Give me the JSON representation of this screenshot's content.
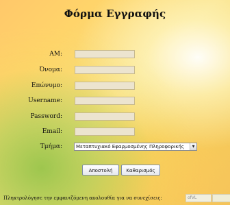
{
  "title": "Φόρμα Εγγραφής",
  "form": {
    "fields": [
      {
        "label": "ΑΜ:",
        "value": ""
      },
      {
        "label": "Όνομα:",
        "value": ""
      },
      {
        "label": "Επώνυμο:",
        "value": ""
      },
      {
        "label": "Username:",
        "value": ""
      },
      {
        "label": "Password:",
        "value": ""
      },
      {
        "label": "Email:",
        "value": ""
      }
    ],
    "department_label": "Τμήμα:",
    "department_selected": "Μεταπτυχιακό Εφαρμοσμένης Πληροφορικής",
    "submit_label": "Αποστολή",
    "reset_label": "Καθαρισμός"
  },
  "captcha": {
    "label": "Πληκτρολόγησε την εμφανιζόμενη ακολουθία για να συνεχίσεις:",
    "code": "ofVL",
    "value": ""
  }
}
